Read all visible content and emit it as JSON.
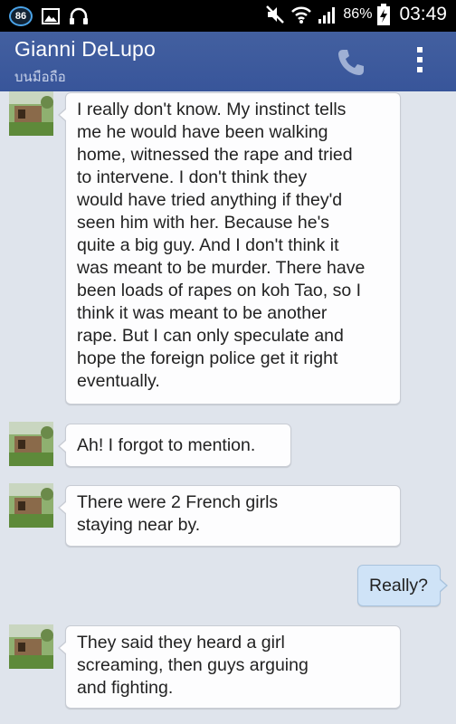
{
  "status_bar": {
    "notification_badge": "86",
    "battery_percent": "86%",
    "time": "03:49",
    "icons": [
      "notification-badge-icon",
      "image-icon",
      "headphones-icon",
      "mute-icon",
      "wifi-icon",
      "signal-icon",
      "battery-charging-icon"
    ]
  },
  "header": {
    "contact_name": "Gianni DeLupo",
    "subtitle": "บนมือถือ",
    "call_icon": "phone-icon",
    "menu_icon": "overflow-menu-icon",
    "color": "#3b5998"
  },
  "messages": [
    {
      "direction": "incoming",
      "text": "I really don't know. My instinct tells\nme he would have been walking\nhome, witnessed the rape and tried\nto intervene. I don't think they\nwould have tried anything if they'd\nseen him with her. Because he's\nquite a big guy. And I don't think it\nwas meant to be murder. There have\nbeen loads of rapes on koh Tao, so I\nthink it was meant to be another\nrape. But I can only speculate and\nhope the foreign police get it right\neventually."
    },
    {
      "direction": "incoming",
      "text": "Ah! I forgot to mention."
    },
    {
      "direction": "incoming",
      "text": "There were 2 French girls\nstaying near by."
    },
    {
      "direction": "outgoing",
      "text": "Really?"
    },
    {
      "direction": "incoming",
      "text": "They said they heard a girl\nscreaming, then guys arguing\nand fighting."
    }
  ]
}
